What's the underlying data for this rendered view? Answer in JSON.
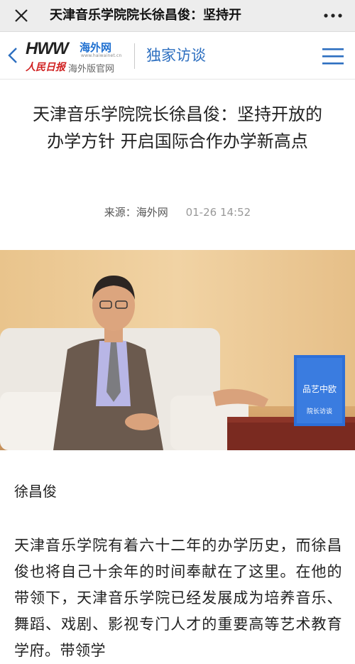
{
  "topbar": {
    "title": "天津音乐学院院长徐昌俊：坚持开",
    "close_icon": "close-icon",
    "more_icon": "more-icon"
  },
  "site": {
    "logo_hww": "HWW",
    "logo_cn": "海外网",
    "logo_url": "www.haiwainet.cn",
    "logo_rmrb": "人民日报",
    "logo_sub": "海外版官网",
    "section": "独家访谈",
    "accent": "#2d6fc0",
    "brand_red": "#d02020"
  },
  "article": {
    "title": "天津音乐学院院长徐昌俊：坚持开放的办学方针 开启国际合作办学新高点",
    "source": "来源：海外网",
    "time": "01-26 14:52",
    "photo_board_text": "品艺中欧",
    "photo_board_sub": "院长访谈",
    "speaker": "徐昌俊",
    "body": "天津音乐学院有着六十二年的办学历史，而徐昌俊也将自己十余年的时间奉献在了这里。在他的带领下，天津音乐学院已经发展成为培养音乐、舞蹈、戏剧、影视专门人才的重要高等艺术教育学府。带领学"
  }
}
